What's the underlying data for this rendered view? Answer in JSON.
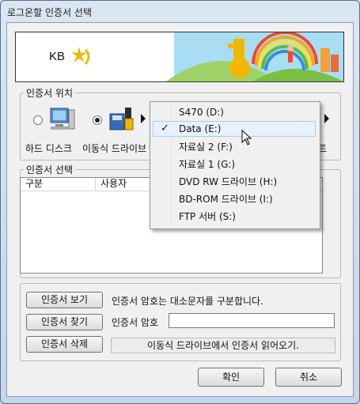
{
  "window": {
    "title": "로그온할 인증서 선택"
  },
  "banner": {
    "logo_text": "KB",
    "brand_color": "#f2b705",
    "sky_color": "#8ed0ee"
  },
  "location": {
    "group_label": "인증서 위치",
    "hard_disk_label": "하드 디스크",
    "removable_label": "이동식 드라이브",
    "truncated_suffix": "트",
    "selected": "removable"
  },
  "cert_list": {
    "group_label": "인증서 선택",
    "columns": [
      "구분",
      "사용자",
      ""
    ]
  },
  "dropdown": {
    "items": [
      {
        "label": "S470 (D:)",
        "checked": false
      },
      {
        "label": "Data (E:)",
        "checked": true
      },
      {
        "label": "자료실 2 (F:)",
        "checked": false
      },
      {
        "label": "자료실 1 (G:)",
        "checked": false
      },
      {
        "label": "DVD RW 드라이브 (H:)",
        "checked": false
      },
      {
        "label": "BD-ROM 드라이브 (I:)",
        "checked": false
      },
      {
        "label": "FTP 서버 (S:)",
        "checked": false
      }
    ],
    "check_glyph": "✓"
  },
  "actions": {
    "view_label": "인증서 보기",
    "find_label": "인증서 찾기",
    "delete_label": "인증서 삭제",
    "case_notice": "인증서 암호는 대소문자를 구분합니다.",
    "password_label": "인증서 암호",
    "password_value": "",
    "status_text": "이동식 드라이브에서 인증서 읽어오기."
  },
  "footer": {
    "ok_label": "확인",
    "cancel_label": "취소"
  }
}
